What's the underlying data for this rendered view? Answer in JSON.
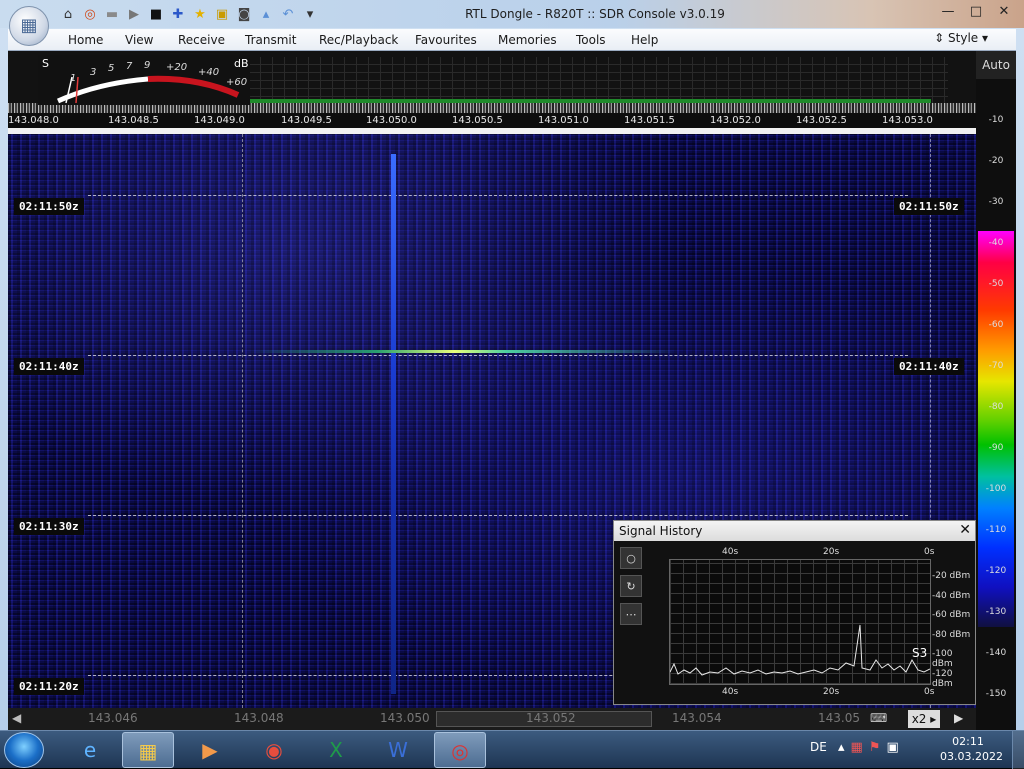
{
  "window": {
    "title": "RTL Dongle - R820T :: SDR Console v3.0.19",
    "minimize": "—",
    "maximize": "□",
    "close": "✕"
  },
  "quick_access": [
    {
      "icon": "home-icon",
      "glyph": "⌂"
    },
    {
      "icon": "lifebuoy-icon",
      "glyph": "◎"
    },
    {
      "icon": "folder-icon",
      "glyph": "▬"
    },
    {
      "icon": "play-icon",
      "glyph": "▶"
    },
    {
      "icon": "stop-icon",
      "glyph": "■"
    },
    {
      "icon": "add-icon",
      "glyph": "✚"
    },
    {
      "icon": "star-icon",
      "glyph": "★"
    },
    {
      "icon": "lock-icon",
      "glyph": "▣"
    },
    {
      "icon": "camera-icon",
      "glyph": "◙"
    },
    {
      "icon": "drop-icon",
      "glyph": "▴"
    },
    {
      "icon": "undo-icon",
      "glyph": "↶"
    },
    {
      "icon": "dropdown-icon",
      "glyph": "▾"
    }
  ],
  "menu": [
    "Home",
    "View",
    "Receive",
    "Transmit",
    "Rec/Playback",
    "Favourites",
    "Memories",
    "Tools",
    "Help"
  ],
  "style_label": "Style",
  "smeter": {
    "s_label": "S",
    "db_label": "dB",
    "s_ticks": [
      "1",
      "3",
      "5",
      "7",
      "9"
    ],
    "db_ticks": [
      "+20",
      "+40",
      "+60"
    ]
  },
  "frequency_ticks": [
    "143.048.0",
    "143.048.5",
    "143.049.0",
    "143.049.5",
    "143.050.0",
    "143.050.5",
    "143.051.0",
    "143.051.5",
    "143.052.0",
    "143.052.5",
    "143.053.0"
  ],
  "waterfall": {
    "time_labels": [
      "02:11:50z",
      "02:11:40z",
      "02:11:30z",
      "02:11:20z"
    ],
    "right_time_labels": [
      "02:11:50z",
      "02:11:40z"
    ]
  },
  "db_scale": {
    "auto_label": "Auto",
    "ticks": [
      "-10",
      "-20",
      "-30",
      "-40",
      "-50",
      "-60",
      "-70",
      "-80",
      "-90",
      "-100",
      "-110",
      "-120",
      "-130",
      "-140",
      "-150"
    ]
  },
  "signal_history": {
    "title": "Signal History",
    "close": "✕",
    "tools": [
      "○",
      "↻",
      "⋯"
    ],
    "x_top": [
      "40s",
      "20s",
      "0s"
    ],
    "x_bottom": [
      "40s",
      "20s",
      "0s"
    ],
    "y_ticks": [
      "-20 dBm",
      "-40 dBm",
      "-60 dBm",
      "-80 dBm",
      "-100 dBm",
      "-120 dBm"
    ],
    "s_reading": "S3"
  },
  "bottom_scale": {
    "ticks": [
      "143.046",
      "143.048",
      "143.050",
      "143.052",
      "143.054",
      "143.05"
    ],
    "zoom": "x2"
  },
  "taskbar": {
    "lang": "DE",
    "time": "02:11",
    "date": "03.03.2022"
  }
}
